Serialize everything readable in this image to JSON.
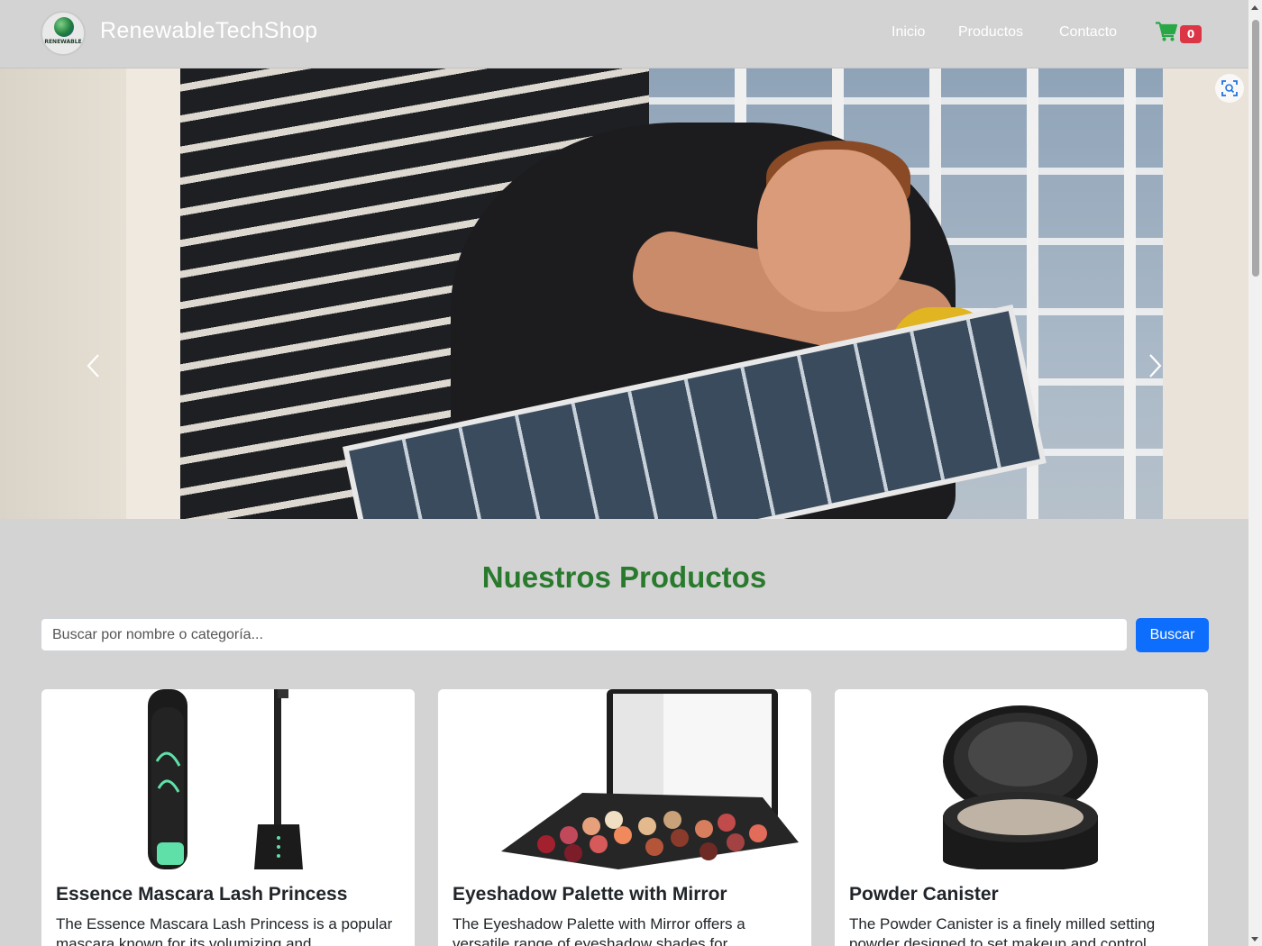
{
  "navbar": {
    "brand": "RenewableTechShop",
    "logo_text": "RENEWABLE",
    "links": [
      "Inicio",
      "Productos",
      "Contacto"
    ],
    "cart_count": "0",
    "cart_icon": "shopping-cart-icon",
    "cart_color": "#28a745",
    "badge_color": "#dc3545"
  },
  "hero": {
    "prev_icon": "chevron-left-icon",
    "next_icon": "chevron-right-icon",
    "visual_search_icon": "visual-search-icon"
  },
  "products_section": {
    "title": "Nuestros Productos",
    "title_color": "#2a7a2e",
    "search": {
      "placeholder": "Buscar por nombre o categoría...",
      "button_label": "Buscar",
      "button_color": "#0d6efd"
    },
    "cards": [
      {
        "title": "Essence Mascara Lash Princess",
        "description": "The Essence Mascara Lash Princess is a popular mascara known for its volumizing and"
      },
      {
        "title": "Eyeshadow Palette with Mirror",
        "description": "The Eyeshadow Palette with Mirror offers a versatile range of eyeshadow shades for"
      },
      {
        "title": "Powder Canister",
        "description": "The Powder Canister is a finely milled setting powder designed to set makeup and control"
      }
    ]
  }
}
